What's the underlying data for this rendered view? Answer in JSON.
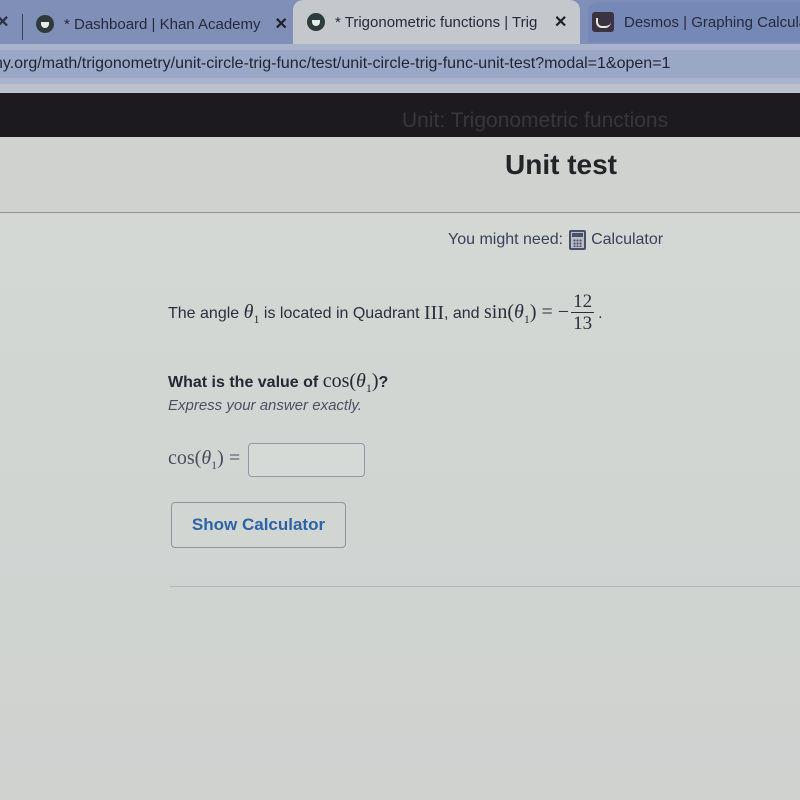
{
  "browser": {
    "tabs": [
      {
        "title": "* Dashboard | Khan Academy",
        "icon": "khan-academy-icon",
        "active": false
      },
      {
        "title": "* Trigonometric functions | Trig",
        "icon": "khan-academy-icon",
        "active": true
      },
      {
        "title": "Desmos | Graphing Calcula",
        "icon": "desmos-icon",
        "active": false
      }
    ],
    "close_glyph": "✕",
    "url": "ny.org/math/trigonometry/unit-circle-trig-func/test/unit-circle-trig-func-unit-test?modal=1&open=1"
  },
  "header": {
    "unit_name": "Unit: Trigonometric functions",
    "title": "Unit test"
  },
  "tools": {
    "label": "You might need:",
    "calculator_icon": "calculator-icon",
    "calculator_link": "Calculator"
  },
  "question": {
    "text_before": "The angle ",
    "theta": "θ",
    "subscript": "1",
    "text_middle": " is located in Quadrant ",
    "quadrant": "III",
    "text_and": ", and ",
    "func": "sin",
    "equals": " = −",
    "numerator": "12",
    "denominator": "13",
    "period": ".",
    "prompt_before": "What is the value of ",
    "prompt_func": "cos",
    "prompt_after": "?",
    "hint": "Express your answer exactly."
  },
  "answer": {
    "label_func": "cos",
    "label_equals": " =",
    "value": "",
    "placeholder": ""
  },
  "buttons": {
    "show_calculator": "Show Calculator"
  },
  "colors": {
    "link_blue": "#2d63a6",
    "tabstrip": "#7f8fb8",
    "dark_band": "#1d1a1f"
  }
}
